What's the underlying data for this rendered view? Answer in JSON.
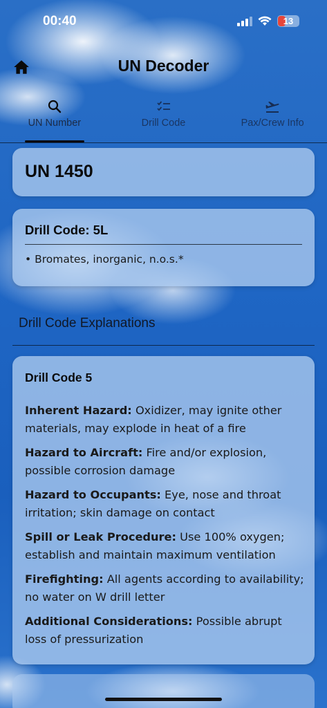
{
  "status_bar": {
    "time": "00:40",
    "battery": "13",
    "battery_level": 0.13,
    "battery_color": "#e5463b"
  },
  "header": {
    "title": "UN Decoder",
    "home_icon": "home-icon"
  },
  "tabs": [
    {
      "label": "UN Number",
      "icon": "search-icon",
      "active": true
    },
    {
      "label": "Drill Code",
      "icon": "checklist-icon",
      "active": false
    },
    {
      "label": "Pax/Crew Info",
      "icon": "airplane-departure-icon",
      "active": false
    }
  ],
  "un_card": {
    "title": "UN 1450"
  },
  "drill_card": {
    "title": "Drill Code: 5L",
    "items": [
      "Bromates, inorganic, n.o.s.*"
    ]
  },
  "explanations": {
    "section_title": "Drill Code Explanations",
    "card_title": "Drill Code 5",
    "items": [
      {
        "key": "Inherent Hazard:",
        "value": "Oxidizer, may ignite other materials, may explode in heat of a fire"
      },
      {
        "key": "Hazard to Aircraft:",
        "value": "Fire and/or explosion, possible corrosion damage"
      },
      {
        "key": "Hazard to Occupants:",
        "value": "Eye, nose and throat irritation; skin damage on contact"
      },
      {
        "key": "Spill or Leak Procedure:",
        "value": "Use 100% oxygen; establish and maintain maximum ventilation"
      },
      {
        "key": "Firefighting:",
        "value": "All agents according to availability; no water on W drill letter"
      },
      {
        "key": "Additional Considerations:",
        "value": "Possible abrupt loss of pressurization"
      }
    ]
  }
}
